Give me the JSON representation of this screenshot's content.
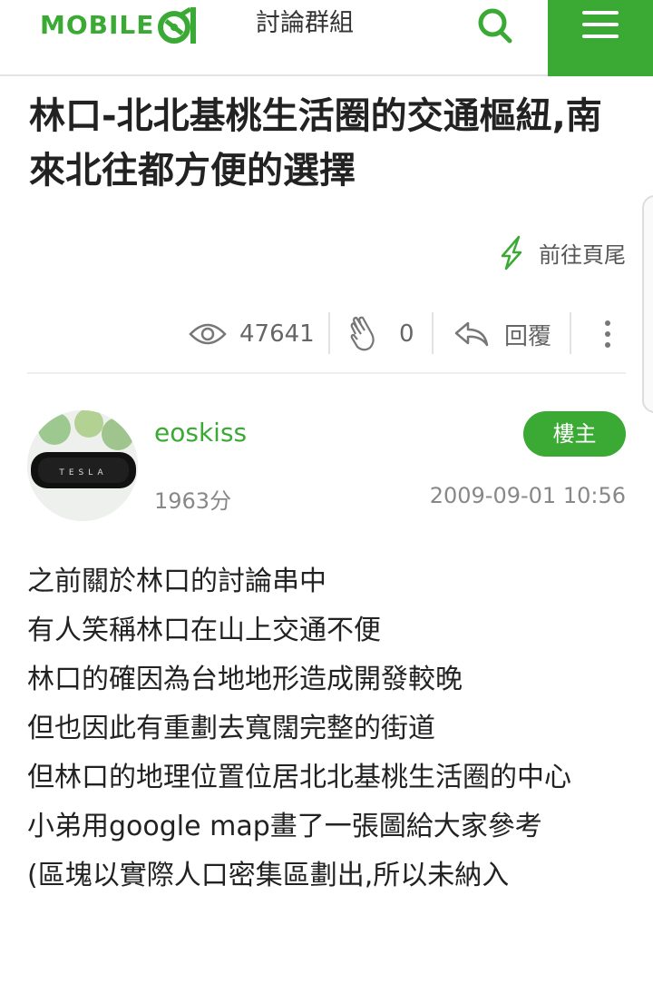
{
  "header": {
    "logo_text": "MOBILE",
    "section_title": "討論群組",
    "brand_color": "#3aaa35"
  },
  "post": {
    "title": "林口-北北基桃生活圈的交通樞紐,南來北往都方便的選擇",
    "goto_end_label": "前往頁尾",
    "stats": {
      "views": "47641",
      "likes": "0",
      "reply_label": "回覆"
    },
    "author": {
      "name": "eoskiss",
      "badge": "樓主",
      "score": "1963分",
      "avatar_text": "TESLA"
    },
    "timestamp": "2009-09-01 10:56",
    "body_lines": [
      "之前關於林口的討論串中",
      "有人笑稱林口在山上交通不便",
      "林口的確因為台地地形造成開發較晚",
      "但也因此有重劃去寬闊完整的街道",
      "但林口的地理位置位居北北基桃生活圈的中心",
      "小弟用google map畫了一張圖給大家參考",
      "(區塊以實際人口密集區劃出,所以未納入"
    ]
  },
  "icons": [
    "search-icon",
    "menu-icon",
    "arrow-down-icon",
    "eye-icon",
    "clap-icon",
    "reply-icon",
    "more-icon"
  ]
}
